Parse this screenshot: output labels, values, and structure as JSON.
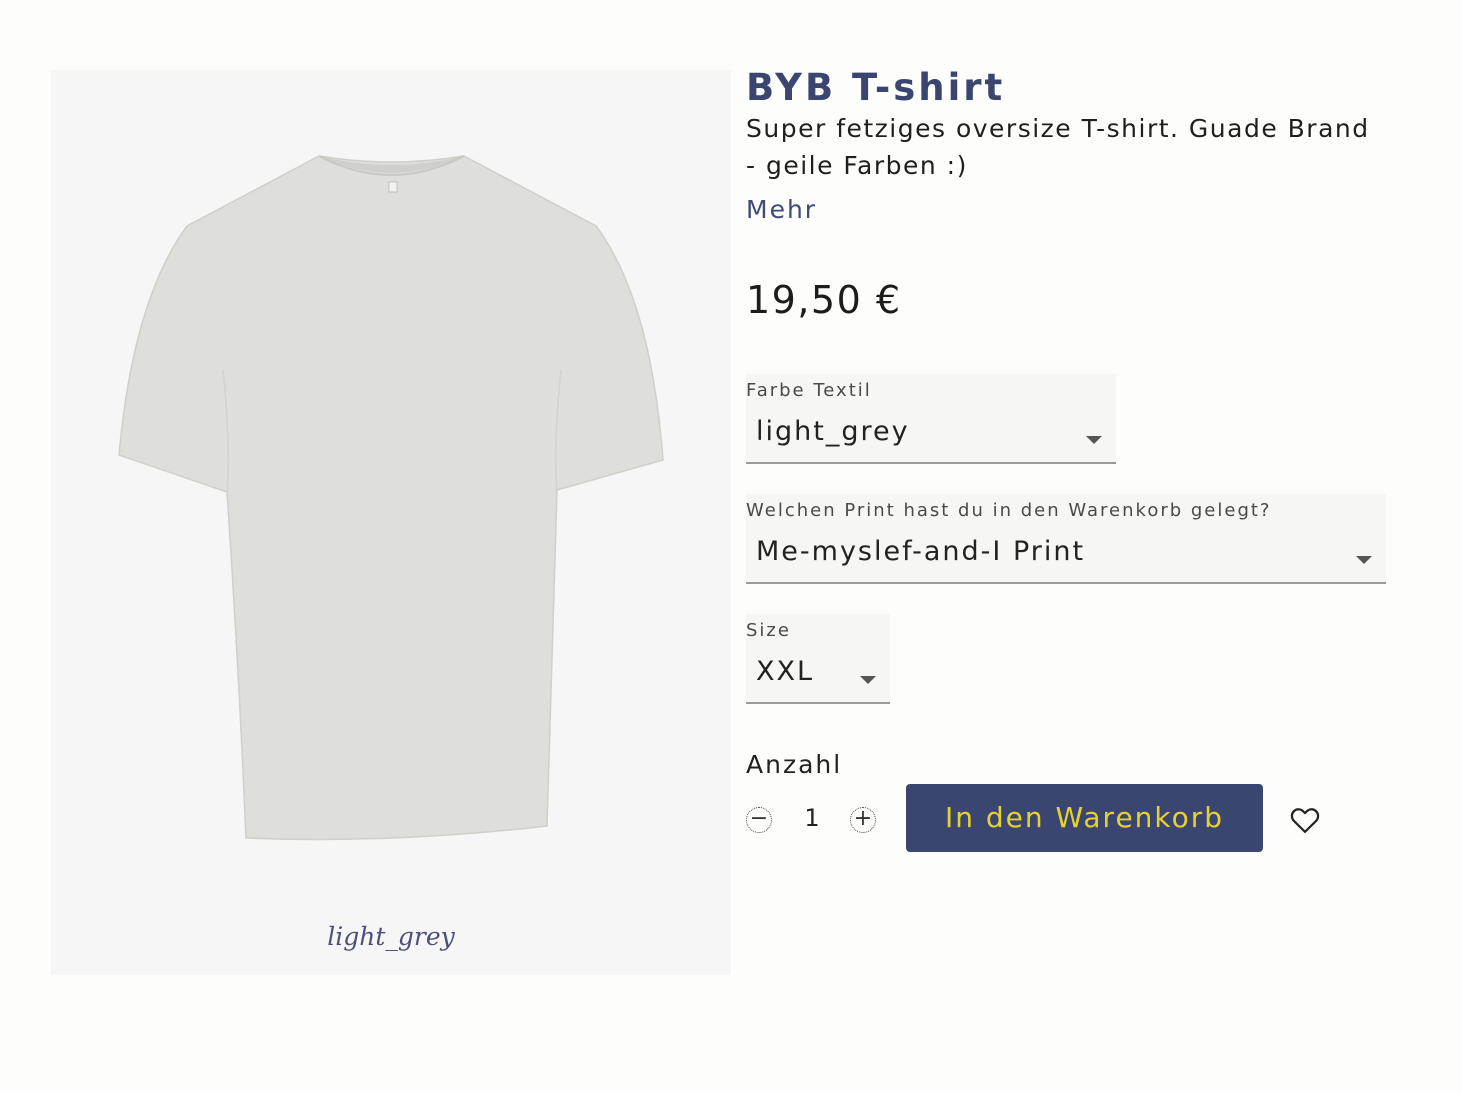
{
  "product": {
    "image_caption": "light_grey",
    "title": "BYB T-shirt",
    "description": "Super fetziges oversize T-shirt. Guade Brand - geile Farben :)",
    "more_label": "Mehr",
    "price": "19,50 €"
  },
  "options": {
    "color": {
      "label": "Farbe Textil",
      "value": "light_grey"
    },
    "print": {
      "label": "Welchen Print hast du in den Warenkorb gelegt?",
      "value": "Me-myslef-and-I Print"
    },
    "size": {
      "label": "Size",
      "value": "XXL"
    }
  },
  "quantity": {
    "label": "Anzahl",
    "value": "1",
    "decrement_icon": "minus-circle-icon",
    "increment_icon": "plus-circle-icon"
  },
  "cart": {
    "button_label": "In den Warenkorb",
    "wishlist_icon": "heart-icon"
  },
  "colors": {
    "brand": "#3a4670",
    "button_text": "#e6d22e",
    "caption": "#4d5077",
    "shirt": "#dededb"
  }
}
